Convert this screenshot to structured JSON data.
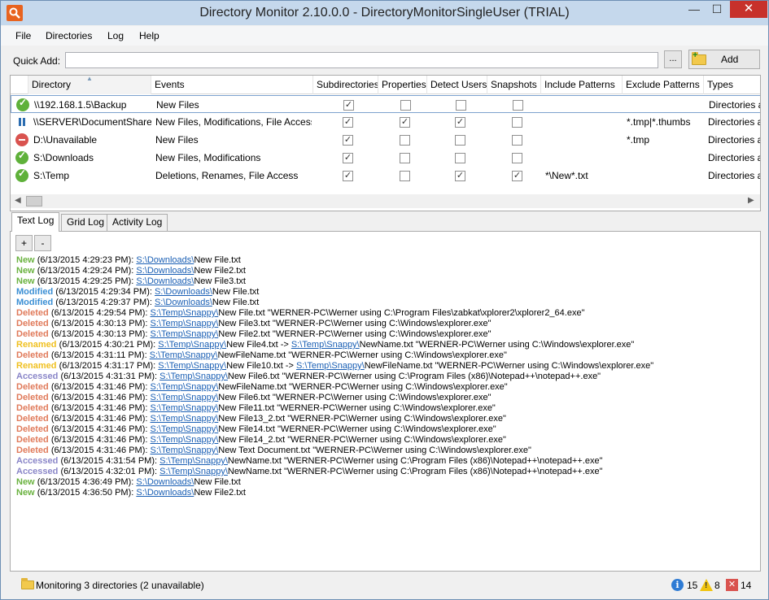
{
  "window": {
    "title": "Directory Monitor 2.10.0.0 - DirectoryMonitorSingleUser (TRIAL)",
    "controls": {
      "minimize": "—",
      "maximize": "☐",
      "close": "✕"
    }
  },
  "menu": [
    "File",
    "Directories",
    "Log",
    "Help"
  ],
  "quick_add": {
    "label": "Quick Add:",
    "value": "",
    "browse_label": "...",
    "add_label": "Add"
  },
  "grid": {
    "columns": [
      "Directory",
      "Events",
      "Subdirectories",
      "Properties",
      "Detect Users",
      "Snapshots",
      "Include Patterns",
      "Exclude Patterns",
      "Types"
    ],
    "rows": [
      {
        "status": "ok",
        "directory": "\\\\192.168.1.5\\Backup",
        "events": "New Files",
        "subdirectories": true,
        "properties": false,
        "detect_users": false,
        "snapshots": false,
        "include": "",
        "exclude": "",
        "types": "Directories a"
      },
      {
        "status": "paused",
        "directory": "\\\\SERVER\\DocumentShare",
        "events": "New Files, Modifications, File Access",
        "subdirectories": true,
        "properties": true,
        "detect_users": true,
        "snapshots": false,
        "include": "",
        "exclude": "*.tmp|*.thumbs",
        "types": "Directories a"
      },
      {
        "status": "error",
        "directory": "D:\\Unavailable",
        "events": "New Files",
        "subdirectories": true,
        "properties": false,
        "detect_users": false,
        "snapshots": false,
        "include": "",
        "exclude": "*.tmp",
        "types": "Directories a"
      },
      {
        "status": "ok",
        "directory": "S:\\Downloads",
        "events": "New Files, Modifications",
        "subdirectories": true,
        "properties": false,
        "detect_users": false,
        "snapshots": false,
        "include": "",
        "exclude": "",
        "types": "Directories a"
      },
      {
        "status": "ok",
        "directory": "S:\\Temp",
        "events": "Deletions, Renames, File Access",
        "subdirectories": true,
        "properties": false,
        "detect_users": true,
        "snapshots": true,
        "include": "*\\New*.txt",
        "exclude": "",
        "types": "Directories a"
      }
    ]
  },
  "tabs": [
    "Text Log",
    "Grid Log",
    "Activity Log"
  ],
  "log_toolbar": {
    "expand": "+",
    "collapse": "-"
  },
  "log": [
    {
      "type": "New",
      "time": "(6/13/2015 4:29:23 PM): ",
      "parts": [
        {
          "link": "S:\\Downloads\\"
        },
        {
          "text": "New File.txt"
        }
      ]
    },
    {
      "type": "New",
      "time": "(6/13/2015 4:29:24 PM): ",
      "parts": [
        {
          "link": "S:\\Downloads\\"
        },
        {
          "text": "New File2.txt"
        }
      ]
    },
    {
      "type": "New",
      "time": "(6/13/2015 4:29:25 PM): ",
      "parts": [
        {
          "link": "S:\\Downloads\\"
        },
        {
          "text": "New File3.txt"
        }
      ]
    },
    {
      "type": "Modified",
      "time": "(6/13/2015 4:29:34 PM): ",
      "parts": [
        {
          "link": "S:\\Downloads\\"
        },
        {
          "text": "New File.txt"
        }
      ]
    },
    {
      "type": "Modified",
      "time": "(6/13/2015 4:29:37 PM): ",
      "parts": [
        {
          "link": "S:\\Downloads\\"
        },
        {
          "text": "New File.txt"
        }
      ]
    },
    {
      "type": "Deleted",
      "time": "(6/13/2015 4:29:54 PM): ",
      "parts": [
        {
          "link": "S:\\Temp\\Snappy\\"
        },
        {
          "text": "New File.txt \"WERNER-PC\\Werner using C:\\Program Files\\zabkat\\xplorer2\\xplorer2_64.exe\""
        }
      ]
    },
    {
      "type": "Deleted",
      "time": "(6/13/2015 4:30:13 PM): ",
      "parts": [
        {
          "link": "S:\\Temp\\Snappy\\"
        },
        {
          "text": "New File3.txt \"WERNER-PC\\Werner using C:\\Windows\\explorer.exe\""
        }
      ]
    },
    {
      "type": "Deleted",
      "time": "(6/13/2015 4:30:13 PM): ",
      "parts": [
        {
          "link": "S:\\Temp\\Snappy\\"
        },
        {
          "text": "New File2.txt \"WERNER-PC\\Werner using C:\\Windows\\explorer.exe\""
        }
      ]
    },
    {
      "type": "Renamed",
      "time": "(6/13/2015 4:30:21 PM): ",
      "parts": [
        {
          "link": "S:\\Temp\\Snappy\\"
        },
        {
          "text": "New File4.txt -> "
        },
        {
          "link": "S:\\Temp\\Snappy\\"
        },
        {
          "text": "NewName.txt \"WERNER-PC\\Werner using C:\\Windows\\explorer.exe\""
        }
      ]
    },
    {
      "type": "Deleted",
      "time": "(6/13/2015 4:31:11 PM): ",
      "parts": [
        {
          "link": "S:\\Temp\\Snappy\\"
        },
        {
          "text": "NewFileName.txt \"WERNER-PC\\Werner using C:\\Windows\\explorer.exe\""
        }
      ]
    },
    {
      "type": "Renamed",
      "time": "(6/13/2015 4:31:17 PM): ",
      "parts": [
        {
          "link": "S:\\Temp\\Snappy\\"
        },
        {
          "text": "New File10.txt -> "
        },
        {
          "link": "S:\\Temp\\Snappy\\"
        },
        {
          "text": "NewFileName.txt \"WERNER-PC\\Werner using C:\\Windows\\explorer.exe\""
        }
      ]
    },
    {
      "type": "Accessed",
      "time": "(6/13/2015 4:31:31 PM): ",
      "parts": [
        {
          "link": "S:\\Temp\\Snappy\\"
        },
        {
          "text": "New File6.txt \"WERNER-PC\\Werner using C:\\Program Files (x86)\\Notepad++\\notepad++.exe\""
        }
      ]
    },
    {
      "type": "Deleted",
      "time": "(6/13/2015 4:31:46 PM): ",
      "parts": [
        {
          "link": "S:\\Temp\\Snappy\\"
        },
        {
          "text": "NewFileName.txt \"WERNER-PC\\Werner using C:\\Windows\\explorer.exe\""
        }
      ]
    },
    {
      "type": "Deleted",
      "time": "(6/13/2015 4:31:46 PM): ",
      "parts": [
        {
          "link": "S:\\Temp\\Snappy\\"
        },
        {
          "text": "New File6.txt \"WERNER-PC\\Werner using C:\\Windows\\explorer.exe\""
        }
      ]
    },
    {
      "type": "Deleted",
      "time": "(6/13/2015 4:31:46 PM): ",
      "parts": [
        {
          "link": "S:\\Temp\\Snappy\\"
        },
        {
          "text": "New File11.txt \"WERNER-PC\\Werner using C:\\Windows\\explorer.exe\""
        }
      ]
    },
    {
      "type": "Deleted",
      "time": "(6/13/2015 4:31:46 PM): ",
      "parts": [
        {
          "link": "S:\\Temp\\Snappy\\"
        },
        {
          "text": "New File13_2.txt \"WERNER-PC\\Werner using C:\\Windows\\explorer.exe\""
        }
      ]
    },
    {
      "type": "Deleted",
      "time": "(6/13/2015 4:31:46 PM): ",
      "parts": [
        {
          "link": "S:\\Temp\\Snappy\\"
        },
        {
          "text": "New File14.txt \"WERNER-PC\\Werner using C:\\Windows\\explorer.exe\""
        }
      ]
    },
    {
      "type": "Deleted",
      "time": "(6/13/2015 4:31:46 PM): ",
      "parts": [
        {
          "link": "S:\\Temp\\Snappy\\"
        },
        {
          "text": "New File14_2.txt \"WERNER-PC\\Werner using C:\\Windows\\explorer.exe\""
        }
      ]
    },
    {
      "type": "Deleted",
      "time": "(6/13/2015 4:31:46 PM): ",
      "parts": [
        {
          "link": "S:\\Temp\\Snappy\\"
        },
        {
          "text": "New Text Document.txt \"WERNER-PC\\Werner using C:\\Windows\\explorer.exe\""
        }
      ]
    },
    {
      "type": "Accessed",
      "time": "(6/13/2015 4:31:54 PM): ",
      "parts": [
        {
          "link": "S:\\Temp\\Snappy\\"
        },
        {
          "text": "NewName.txt \"WERNER-PC\\Werner using C:\\Program Files (x86)\\Notepad++\\notepad++.exe\""
        }
      ]
    },
    {
      "type": "Accessed",
      "time": "(6/13/2015 4:32:01 PM): ",
      "parts": [
        {
          "link": "S:\\Temp\\Snappy\\"
        },
        {
          "text": "NewName.txt \"WERNER-PC\\Werner using C:\\Program Files (x86)\\Notepad++\\notepad++.exe\""
        }
      ]
    },
    {
      "type": "New",
      "time": "(6/13/2015 4:36:49 PM): ",
      "parts": [
        {
          "link": "S:\\Downloads\\"
        },
        {
          "text": "New File.txt"
        }
      ]
    },
    {
      "type": "New",
      "time": "(6/13/2015 4:36:50 PM): ",
      "parts": [
        {
          "link": "S:\\Downloads\\"
        },
        {
          "text": "New File2.txt"
        }
      ]
    }
  ],
  "status_bar": {
    "text": "Monitoring 3 directories (2 unavailable)",
    "info_count": "15",
    "warning_count": "8",
    "error_count": "14"
  },
  "colors": {
    "new": "#6ab23f",
    "modified": "#3b8fd4",
    "deleted": "#e07a5a",
    "renamed": "#f0c020",
    "accessed": "#8a86c8",
    "close_button": "#c7312b"
  },
  "icons": [
    "app-icon",
    "folder-icon",
    "info-icon",
    "warning-icon",
    "error-icon",
    "status-ok-icon",
    "status-paused-icon",
    "status-error-icon"
  ]
}
